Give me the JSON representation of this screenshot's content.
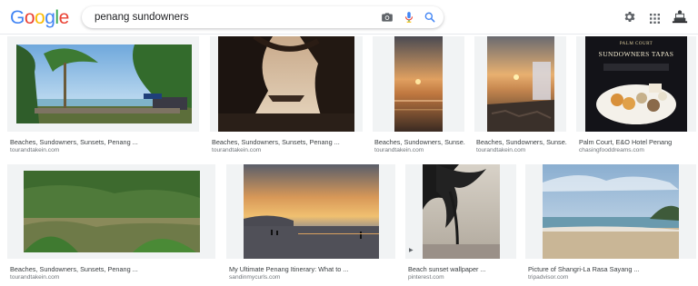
{
  "logo": {
    "text": "Google",
    "letters": [
      "G",
      "o",
      "o",
      "g",
      "l",
      "e"
    ],
    "colors": [
      "#4285f4",
      "#ea4335",
      "#fbbc05",
      "#4285f4",
      "#34a853",
      "#ea4335"
    ]
  },
  "search": {
    "query": "penang sundowners",
    "icons": [
      "camera-icon",
      "mic-icon",
      "search-icon"
    ]
  },
  "header_icons": [
    "gear-icon",
    "apps-grid-icon",
    "account-avatar-icon"
  ],
  "results": [
    {
      "title": "Beaches, Sundowners, Sunsets, Penang ...",
      "source": "tourandtakein.com"
    },
    {
      "title": "Beaches, Sundowners, Sunsets, Penang ...",
      "source": "tourandtakein.com"
    },
    {
      "title": "Beaches, Sundowners, Sunse...",
      "source": "tourandtakein.com"
    },
    {
      "title": "Beaches, Sundowners, Sunse...",
      "source": "tourandtakein.com"
    },
    {
      "title": "Palm Court, E&O Hotel Penang",
      "source": "chasingfooddreams.com"
    },
    {
      "title": "Beaches, Sundowners, Sunsets, Penang ...",
      "source": "tourandtakein.com"
    },
    {
      "title": "My Ultimate Penang Itinerary: What to ...",
      "source": "sandinmycurls.com"
    },
    {
      "title": "Beach sunset wallpaper ...",
      "source": "pinterest.com"
    },
    {
      "title": "Picture of Shangri-La Rasa Sayang ...",
      "source": "tripadvisor.com"
    }
  ],
  "image_text": {
    "palm_court": "PALM COURT",
    "sundowners_tapas": "SUNDOWNERS TAPAS"
  },
  "video_marker": "▶"
}
